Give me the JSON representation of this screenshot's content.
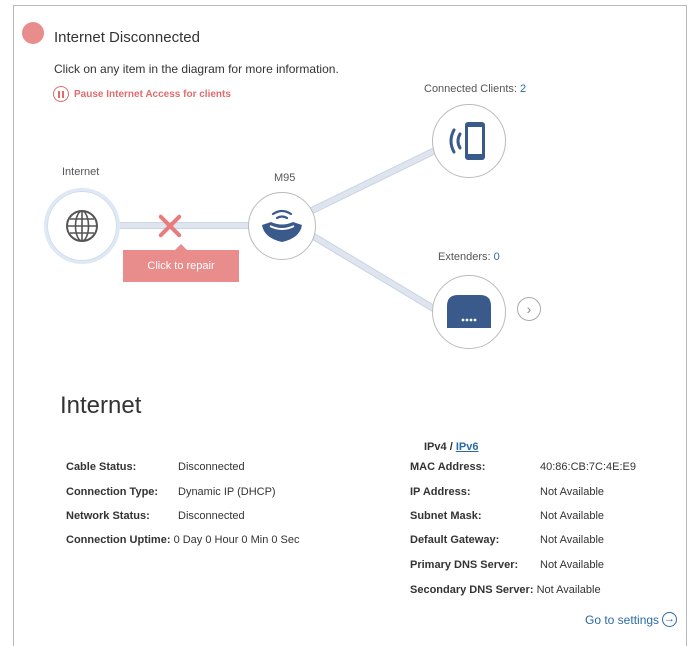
{
  "status": {
    "text": "Internet Disconnected",
    "color": "#e88c8c"
  },
  "hint": "Click on any item in the diagram for more information.",
  "pause_label": "Pause Internet Access for clients",
  "diagram": {
    "internet_label": "Internet",
    "router_label": "M95",
    "clients_label": "Connected Clients:",
    "clients_count": "2",
    "extenders_label": "Extenders:",
    "extenders_count": "0",
    "repair_label": "Click to repair"
  },
  "section_title": "Internet",
  "ip_tabs": {
    "ipv4": "IPv4",
    "separator": "/",
    "ipv6": "IPv6"
  },
  "left_info": [
    {
      "label": "Cable Status:",
      "value": "Disconnected"
    },
    {
      "label": "Connection Type:",
      "value": "Dynamic IP (DHCP)"
    },
    {
      "label": "Network Status:",
      "value": "Disconnected"
    },
    {
      "label": "Connection Uptime:",
      "value": "0 Day 0 Hour 0 Min 0 Sec"
    }
  ],
  "right_info": [
    {
      "label": "MAC Address:",
      "value": "40:86:CB:7C:4E:E9"
    },
    {
      "label": "IP Address:",
      "value": "Not Available"
    },
    {
      "label": "Subnet Mask:",
      "value": "Not Available"
    },
    {
      "label": "Default Gateway:",
      "value": "Not Available"
    },
    {
      "label": "Primary DNS Server:",
      "value": "Not Available"
    },
    {
      "label": "Secondary DNS Server:",
      "value": "Not Available"
    }
  ],
  "goto_settings": "Go to settings",
  "colors": {
    "accent": "#2b6aa8",
    "error": "#e06c6c",
    "device": "#3a5a8c"
  }
}
